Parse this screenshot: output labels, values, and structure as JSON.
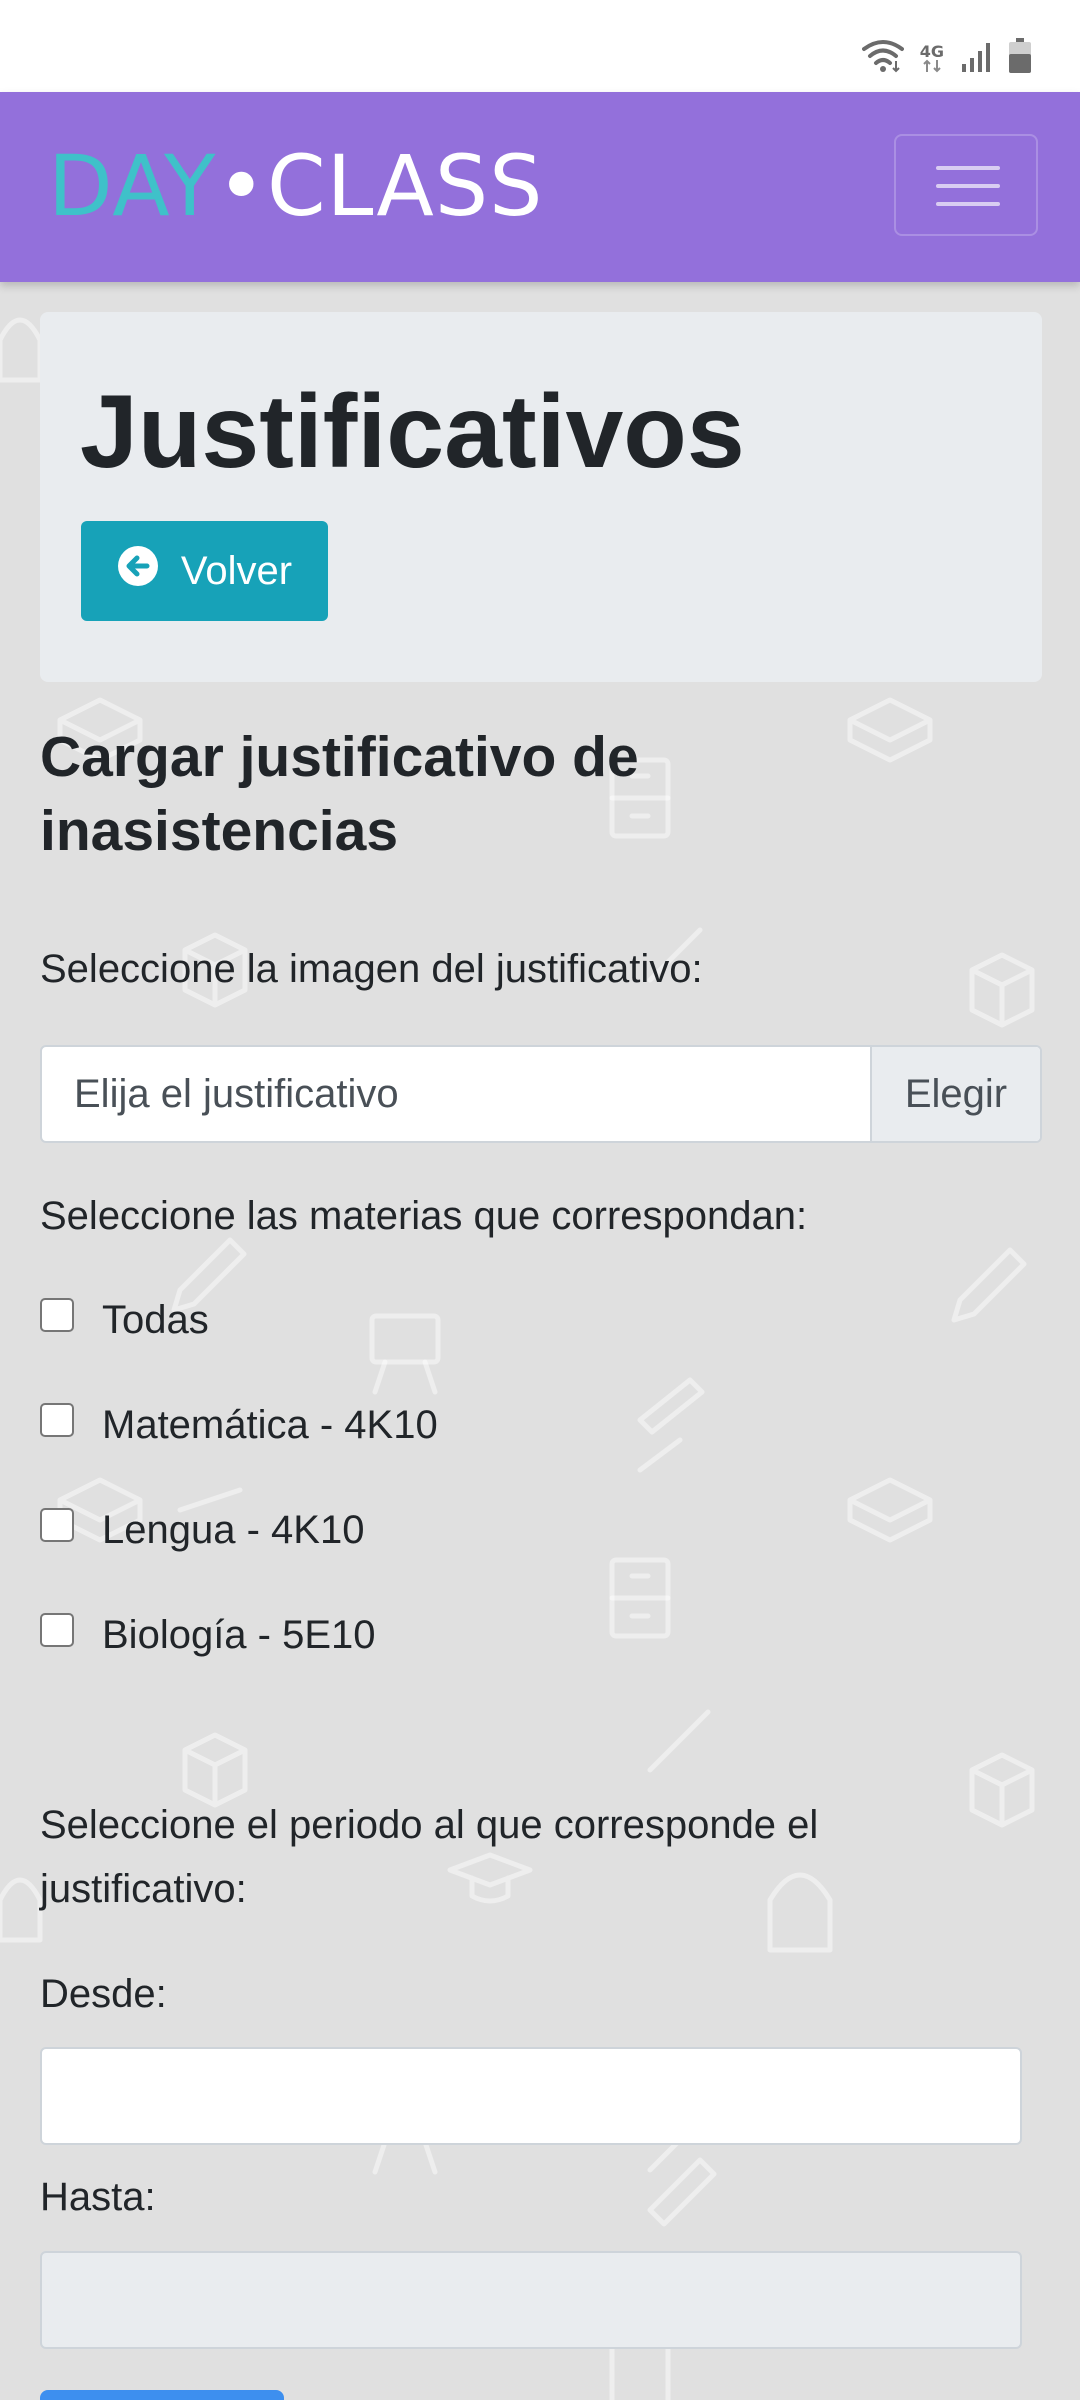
{
  "status_bar": {
    "network_label": "4G",
    "icons": [
      "wifi-icon",
      "mobile-data-icon",
      "signal-icon",
      "battery-icon"
    ]
  },
  "navbar": {
    "brand_day": "DAY",
    "brand_dot": "•",
    "brand_class": "CLASS",
    "menu_icon": "hamburger-icon",
    "colors": {
      "background": "#9370db",
      "brand_accent": "#3fc1c9"
    }
  },
  "header": {
    "title": "Justificativos",
    "back_button": {
      "label": "Volver",
      "icon": "arrow-circle-left-icon",
      "color": "#17a2b8"
    }
  },
  "form": {
    "title": "Cargar justificativo de inasistencias",
    "image_label": "Seleccione la imagen del justificativo:",
    "file_placeholder": "Elija el justificativo",
    "file_button": "Elegir",
    "subjects_label": "Seleccione las materias que correspondan:",
    "subjects": [
      {
        "label": "Todas",
        "checked": false
      },
      {
        "label": "Matemática - 4K10",
        "checked": false
      },
      {
        "label": "Lengua - 4K10",
        "checked": false
      },
      {
        "label": "Biología - 5E10",
        "checked": false
      }
    ],
    "period_label": "Seleccione el periodo al que corresponde el justificativo:",
    "from_label": "Desde:",
    "from_value": "",
    "to_label": "Hasta:",
    "to_value": ""
  }
}
